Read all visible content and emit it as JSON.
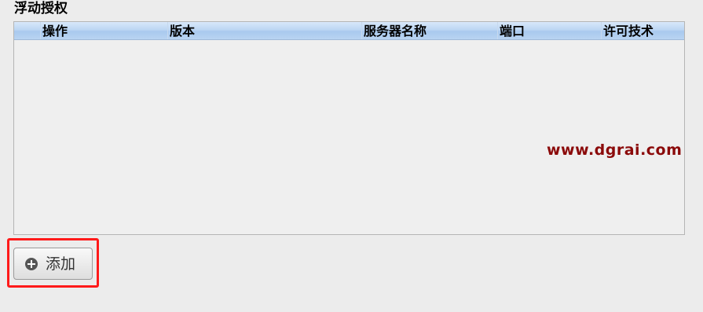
{
  "section": {
    "title": "浮动授权"
  },
  "table": {
    "columns": [
      "操作",
      "版本",
      "服务器名称",
      "端口",
      "许可技术"
    ],
    "rows": []
  },
  "watermark": {
    "text": "www.dgrai.com",
    "color": "#8b0a0a"
  },
  "add_button": {
    "label": "添加",
    "icon": "plus-circle-icon"
  },
  "colors": {
    "highlight": "#ff1a1a",
    "header_gradient": "#bcd6f3"
  }
}
